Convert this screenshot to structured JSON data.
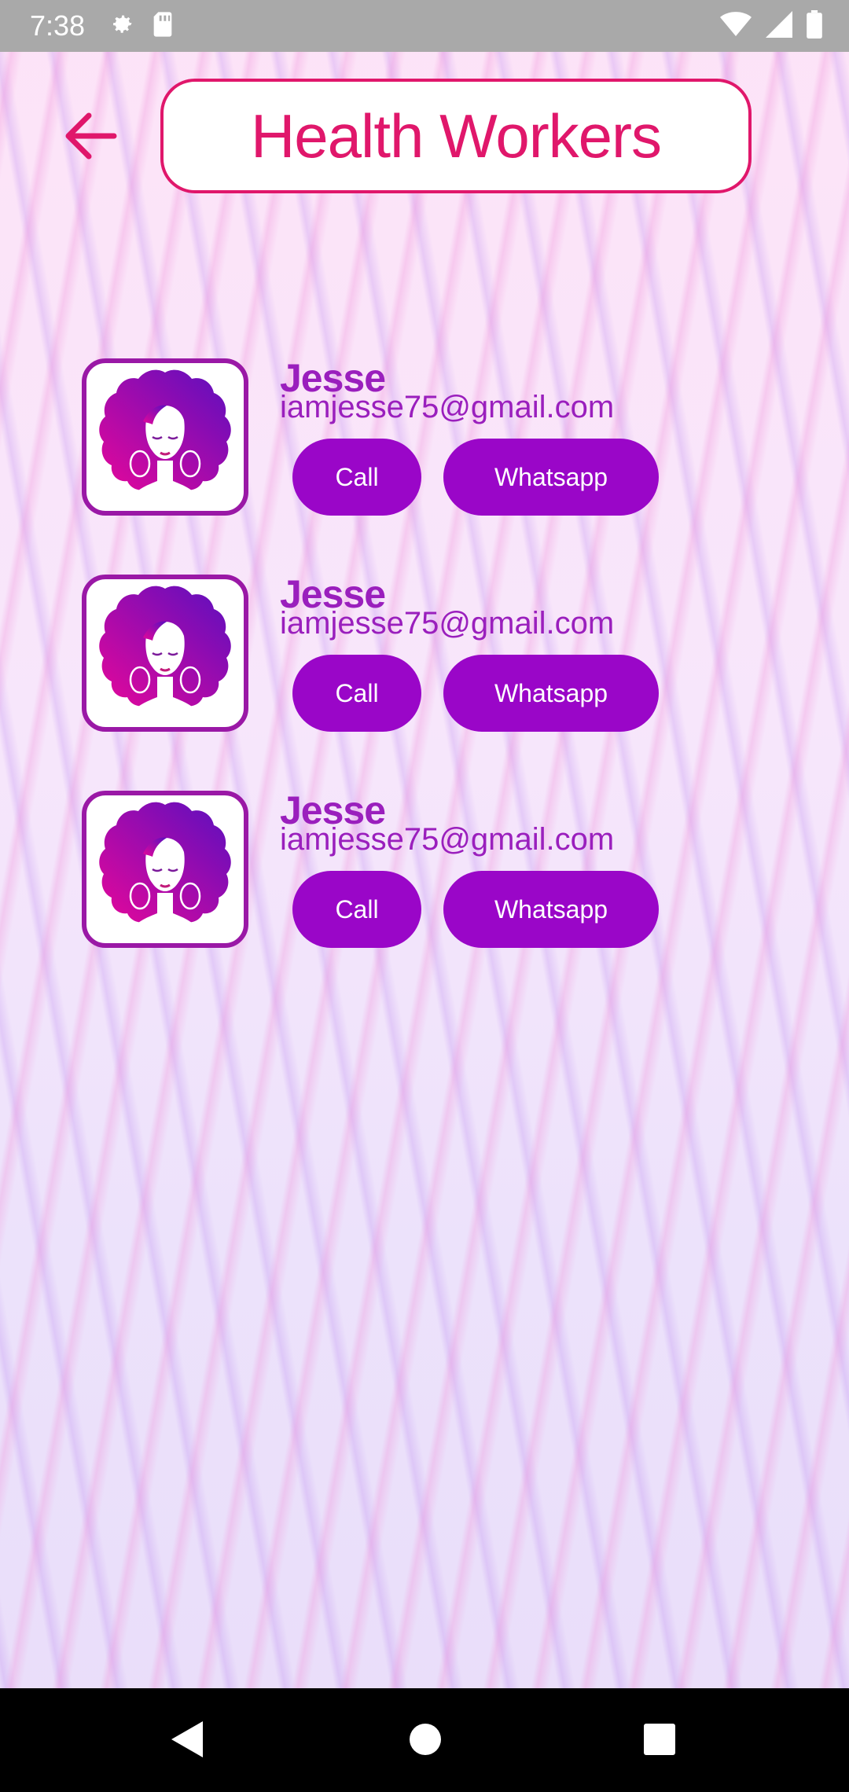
{
  "status_bar": {
    "time": "7:38",
    "icons_left": [
      "settings-icon",
      "sd-card-icon"
    ],
    "icons_right": [
      "wifi-icon",
      "signal-icon",
      "battery-icon"
    ]
  },
  "header": {
    "back_icon": "arrow-left-icon",
    "title": "Health Workers"
  },
  "workers": [
    {
      "name": "Jesse",
      "email": "iamjesse75@gmail.com",
      "call_label": "Call",
      "whatsapp_label": "Whatsapp"
    },
    {
      "name": "Jesse",
      "email": "iamjesse75@gmail.com",
      "call_label": "Call",
      "whatsapp_label": "Whatsapp"
    },
    {
      "name": "Jesse",
      "email": "iamjesse75@gmail.com",
      "call_label": "Call",
      "whatsapp_label": "Whatsapp"
    }
  ],
  "nav_bar": {
    "buttons": [
      "back-triangle-icon",
      "home-circle-icon",
      "recents-square-icon"
    ]
  },
  "colors": {
    "accent": "#e0176b",
    "purple_text": "#9a1fbd",
    "button_bg": "#9a06c8",
    "avatar_border": "#9a18a6"
  }
}
